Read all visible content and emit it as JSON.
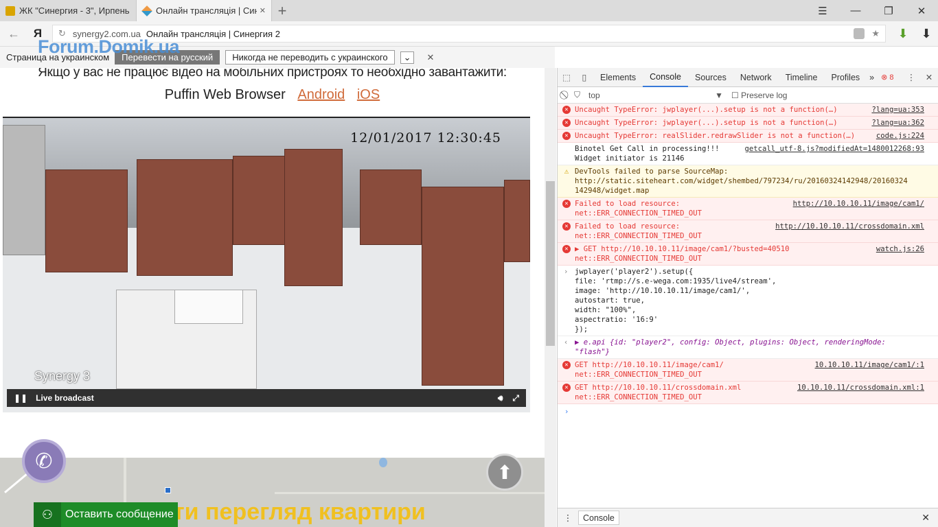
{
  "tabs": [
    {
      "title": "ЖК \"Синергия - 3\", Ирпень",
      "close": ""
    },
    {
      "title": "Онлайн трансляція | Синергия 2",
      "close": "✕"
    }
  ],
  "window": {
    "menu": "☰",
    "minimize": "—",
    "restore": "❐",
    "close": "✕"
  },
  "address": {
    "back": "←",
    "ya": "Я",
    "reload": "↻",
    "domain": "synergy2.com.ua",
    "page_title": "Онлайн трансляція | Синергия 2",
    "star": "★",
    "download": "⬇"
  },
  "translate": {
    "label": "Страница на украинском",
    "translate_btn": "Перевести на русский",
    "never_btn": "Никогда не переводить с украинского",
    "dropdown": "⌄",
    "close": "✕"
  },
  "watermark": "Forum.Domik.ua",
  "page": {
    "notice": "Якщо у вас не працює відео на мобільних пристроях то необхідно завантажити:",
    "puffin": "Puffin Web Browser",
    "android": "Android",
    "ios": "iOS",
    "stamp": "12/01/2017  12:30:45",
    "cam_label": "Synergy 3",
    "player_status": "Live broadcast",
    "yellow_heading": "ти перегляд квартири",
    "message_btn": "Оставить сообщение"
  },
  "devtools": {
    "tabs": [
      "Elements",
      "Console",
      "Sources",
      "Network",
      "Timeline",
      "Profiles"
    ],
    "more": "»",
    "errors_count": "8",
    "context": "top",
    "preserve_log": "Preserve log",
    "console_rows": [
      {
        "type": "error",
        "msg": "Uncaught TypeError: jwplayer(...).setup is not a function(…)",
        "src": "?lang=ua:353"
      },
      {
        "type": "error",
        "msg": "Uncaught TypeError: jwplayer(...).setup is not a function(…)",
        "src": "?lang=ua:362"
      },
      {
        "type": "error",
        "msg": "Uncaught TypeError: realSlider.redrawSlider is not a function(…)",
        "src": "code.js:224"
      },
      {
        "type": "log",
        "msg": "Binotel Get Call in processing!!!\nWidget initiator is 21146",
        "src": "getcall_utf-8.js?modifiedAt=1480012268:93"
      },
      {
        "type": "warn",
        "msg": "DevTools failed to parse SourceMap:\nhttp://static.siteheart.com/widget/shembed/797234/ru/20160324142948/20160324\n142948/widget.map",
        "src": ""
      },
      {
        "type": "error",
        "msg": "Failed to load resource:\nnet::ERR_CONNECTION_TIMED_OUT",
        "src": "http://10.10.10.11/image/cam1/"
      },
      {
        "type": "error",
        "msg": "Failed to load resource:\nnet::ERR_CONNECTION_TIMED_OUT",
        "src": "http://10.10.10.11/crossdomain.xml"
      },
      {
        "type": "error",
        "msg": "▶ GET http://10.10.10.11/image/cam1/?busted=40510\nnet::ERR_CONNECTION_TIMED_OUT",
        "src": "watch.js:26"
      }
    ],
    "input_code": "jwplayer('player2').setup({\nfile: 'rtmp://s.e-wega.com:1935/live4/stream',\nimage: 'http://10.10.10.11/image/cam1/',\nautostart: true,\nwidth: \"100%\",\naspectratio: '16:9'\n});",
    "result": "▶ e.api {id: \"player2\", config: Object, plugins: Object, renderingMode:\n\"flash\"}",
    "console_rows2": [
      {
        "type": "error",
        "msg": "GET http://10.10.10.11/image/cam1/\nnet::ERR_CONNECTION_TIMED_OUT",
        "src": "10.10.10.11/image/cam1/:1"
      },
      {
        "type": "error",
        "msg": "GET http://10.10.10.11/crossdomain.xml\nnet::ERR_CONNECTION_TIMED_OUT",
        "src": "10.10.10.11/crossdomain.xml:1"
      }
    ],
    "drawer_tab": "Console"
  },
  "colors": {
    "accent": "#3879d9",
    "error": "#e53935",
    "brand_green": "#1e8c28",
    "yellow": "#f0c020"
  }
}
